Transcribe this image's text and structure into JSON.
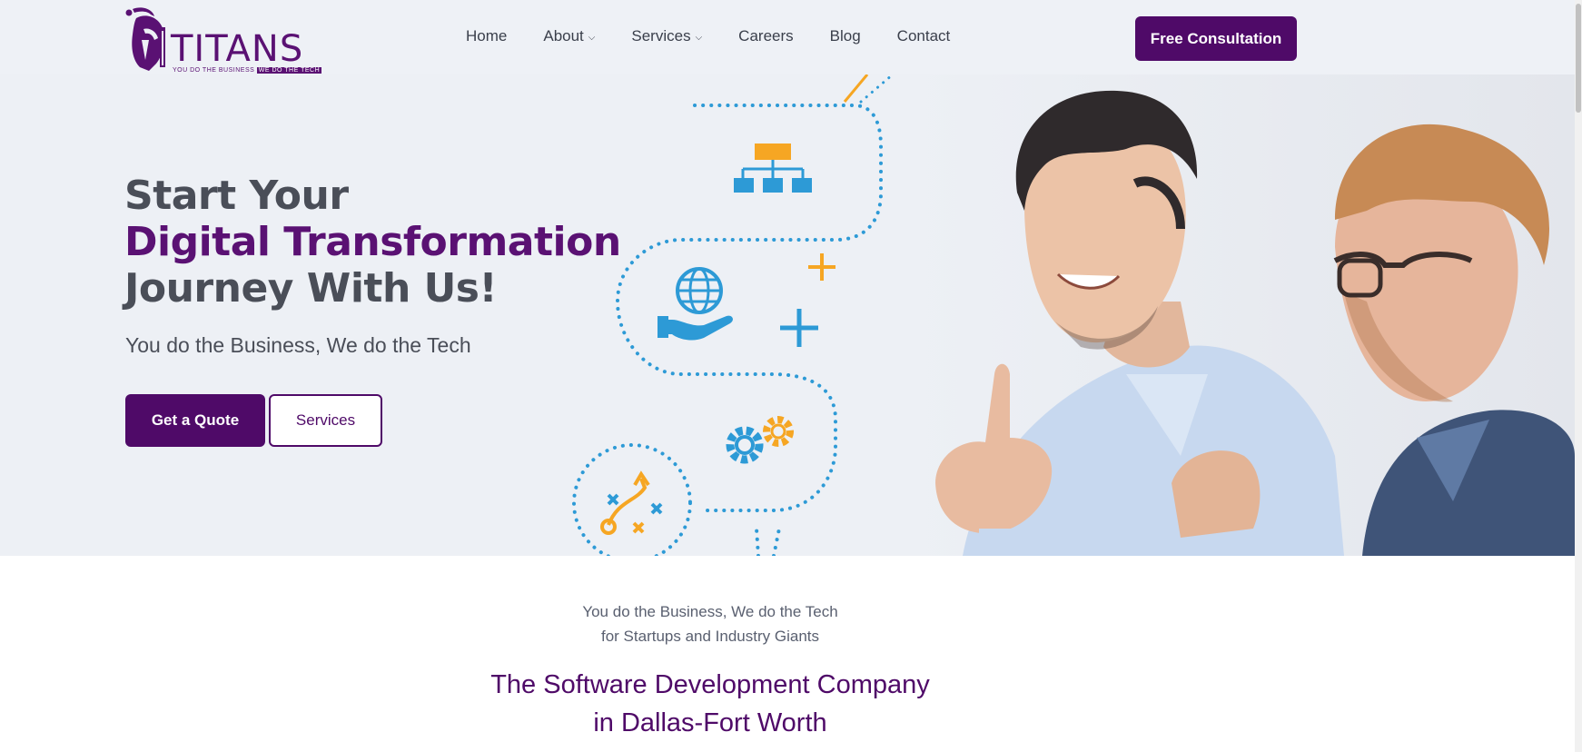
{
  "brand": {
    "name": "TITANS",
    "tagline_left": "YOU DO THE BUSINESS",
    "tagline_right": "WE DO THE TECH",
    "primary": "#4f0a68",
    "accent_orange": "#f6a623",
    "accent_blue": "#2d9ad6"
  },
  "nav": {
    "items": [
      {
        "label": "Home",
        "dropdown": false
      },
      {
        "label": "About",
        "dropdown": true
      },
      {
        "label": "Services",
        "dropdown": true
      },
      {
        "label": "Careers",
        "dropdown": false
      },
      {
        "label": "Blog",
        "dropdown": false
      },
      {
        "label": "Contact",
        "dropdown": false
      }
    ],
    "cta_label": "Free Consultation"
  },
  "hero": {
    "title_line1": "Start Your",
    "title_line2": "Digital Transformation",
    "title_line3": "Journey With Us!",
    "subtitle": "You do the Business, We do the Tech",
    "quote_button": "Get a Quote",
    "services_button": "Services",
    "icons": [
      "org-chart-icon",
      "globe-hand-icon",
      "plus-icon",
      "gears-icon",
      "strategy-icon"
    ]
  },
  "intro": {
    "line1": "You do the Business, We do the Tech",
    "line2": "for Startups and Industry Giants",
    "heading_line1": "The Software Development Company",
    "heading_line2": "in Dallas-Fort Worth"
  }
}
